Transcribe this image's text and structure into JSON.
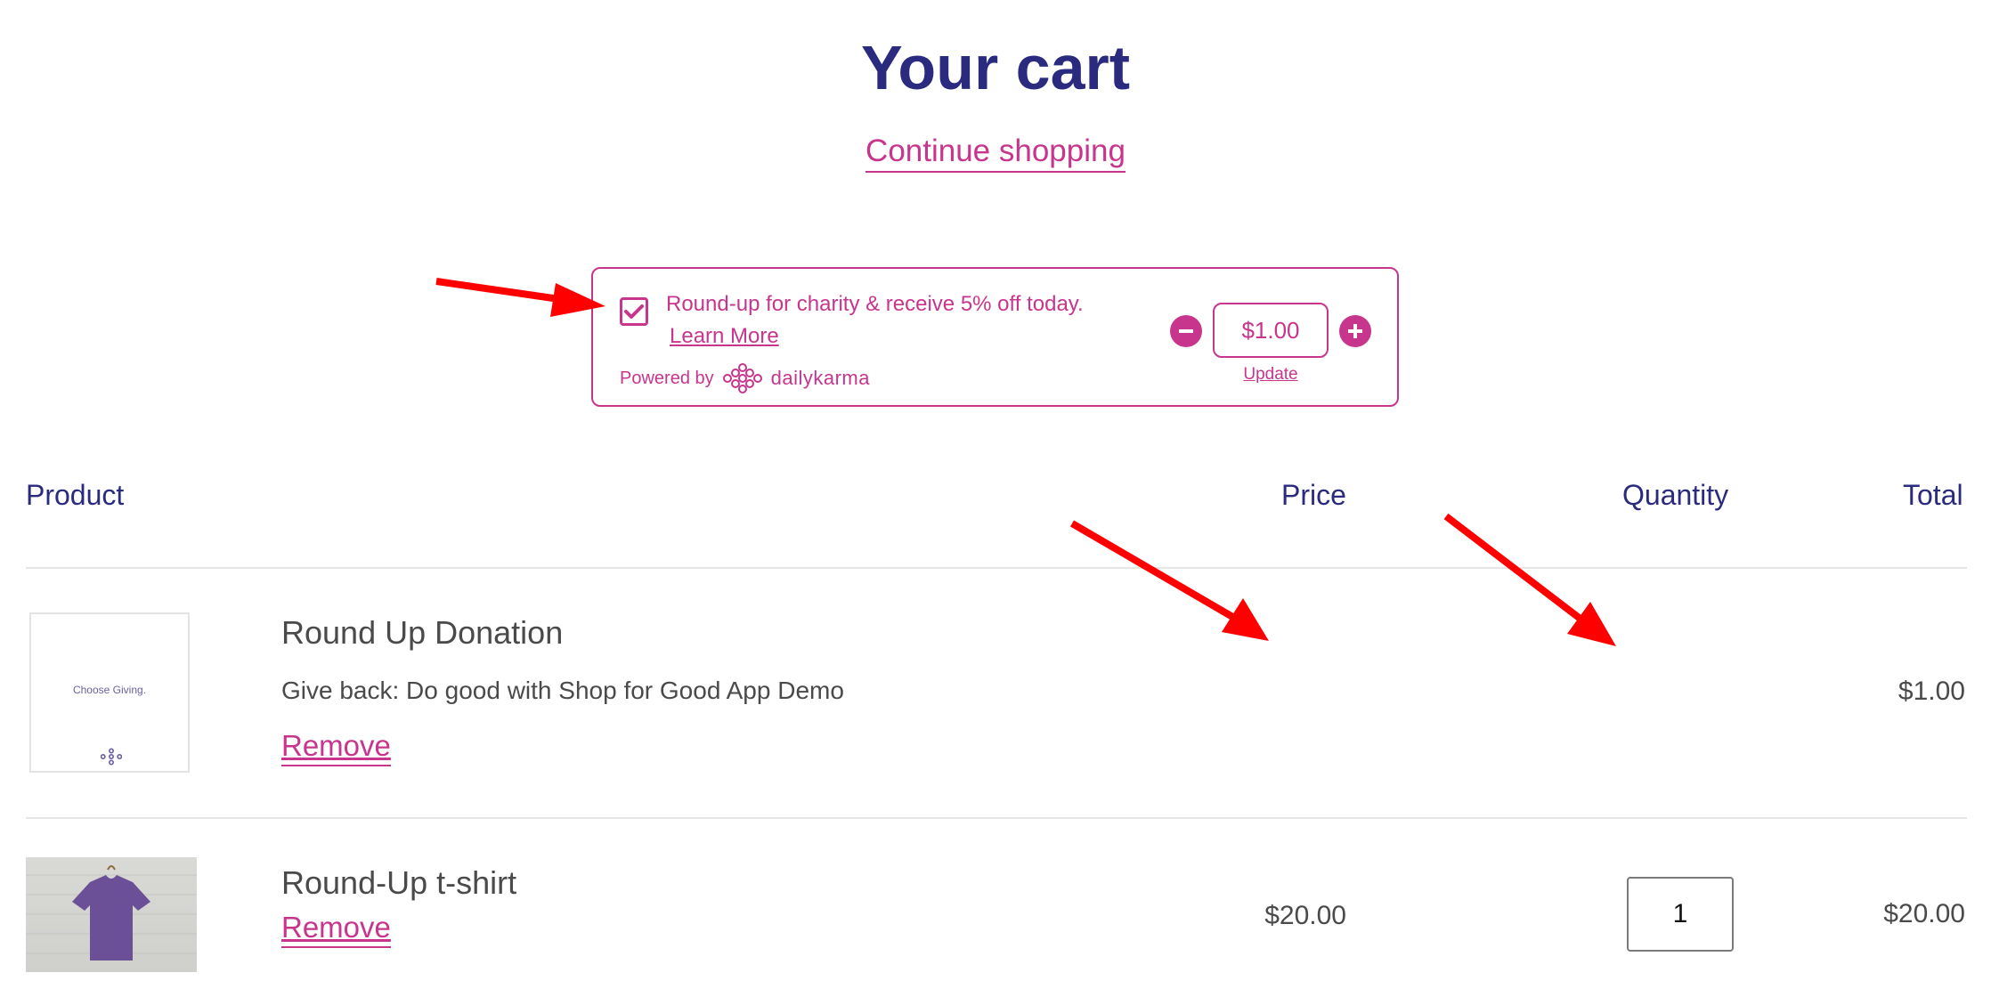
{
  "header": {
    "title": "Your cart",
    "continue_label": "Continue shopping"
  },
  "roundup": {
    "checked": true,
    "text": "Round-up for charity & receive 5% off today.",
    "learn_more": "Learn More",
    "powered_by": "Powered by",
    "brand": "dailykarma",
    "amount": "$1.00",
    "update_label": "Update",
    "accent_color": "#c7358d"
  },
  "table": {
    "headers": {
      "product": "Product",
      "price": "Price",
      "quantity": "Quantity",
      "total": "Total"
    },
    "rows": [
      {
        "name": "Round Up Donation",
        "description": "Give back: Do good with Shop for Good App Demo",
        "remove_label": "Remove",
        "thumb_text": "Choose Giving.",
        "price": "",
        "quantity": "",
        "total": "$1.00"
      },
      {
        "name": "Round-Up t-shirt",
        "remove_label": "Remove",
        "price": "$20.00",
        "quantity": "1",
        "total": "$20.00"
      }
    ]
  },
  "colors": {
    "title": "#2a2a7e",
    "accent": "#c7358d",
    "annotation_arrow": "#ff0000"
  }
}
